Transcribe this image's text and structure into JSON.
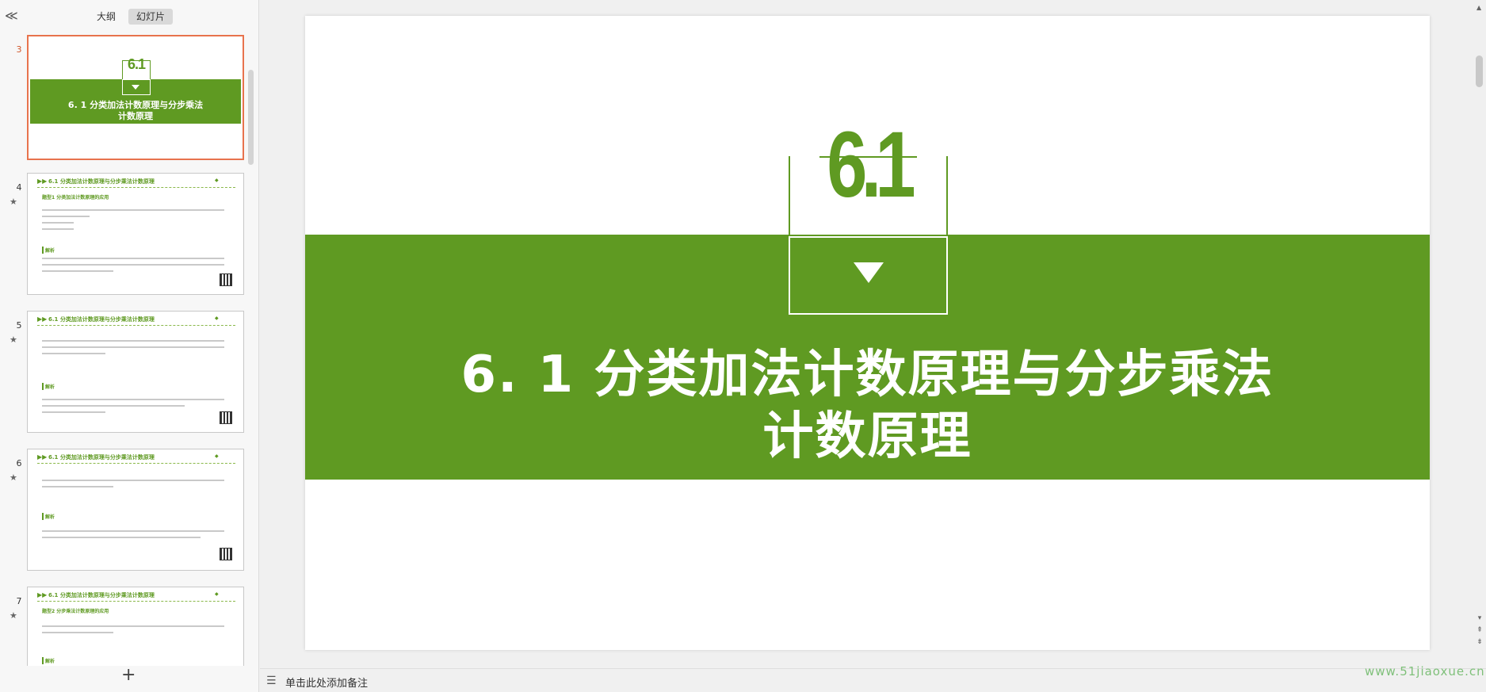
{
  "left_panel": {
    "collapse_icon": "≪",
    "tabs": [
      {
        "label": "大纲",
        "active": false
      },
      {
        "label": "幻灯片",
        "active": true
      }
    ],
    "slides": [
      {
        "number": "3",
        "selected": true,
        "star": ""
      },
      {
        "number": "4",
        "selected": false,
        "star": "★",
        "head_title": "6.1 分类加法计数原理与分步乘法计数原理",
        "subtitle": "题型1  分类加法计数原理的应用",
        "jiexi": "解析"
      },
      {
        "number": "5",
        "selected": false,
        "star": "★",
        "head_title": "6.1 分类加法计数原理与分步乘法计数原理",
        "subtitle": "",
        "jiexi": "解析"
      },
      {
        "number": "6",
        "selected": false,
        "star": "★",
        "head_title": "6.1 分类加法计数原理与分步乘法计数原理",
        "subtitle": "",
        "jiexi": "解析"
      },
      {
        "number": "7",
        "selected": false,
        "star": "★",
        "head_title": "6.1 分类加法计数原理与分步乘法计数原理",
        "subtitle": "题型2  分步乘法计数原理的应用",
        "jiexi": "解析"
      }
    ],
    "add_slide_icon": "+"
  },
  "slide": {
    "number_text": "6.1",
    "title_line1": "6. 1  分类加法计数原理与分步乘法",
    "title_line2": "计数原理"
  },
  "notes": {
    "icon": "list-icon",
    "placeholder": "单击此处添加备注"
  },
  "watermark": "www.51jiaoxue.cn",
  "colors": {
    "accent_green": "#5f9a22",
    "selected_border": "#e8734d"
  }
}
